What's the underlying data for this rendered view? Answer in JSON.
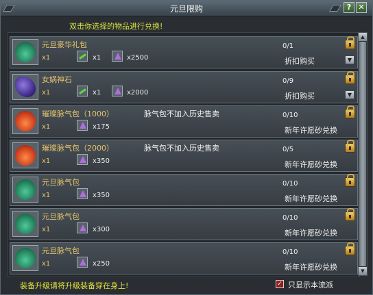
{
  "window": {
    "title": "元旦限购",
    "help_label": "?",
    "close_label": "✕"
  },
  "hint": "双击你选择的物品进行兑换!",
  "items": [
    {
      "name": "元旦豪华礼包",
      "note": "",
      "qty": "x1",
      "cost": [
        {
          "icon": "green-jade",
          "amount": "x1"
        },
        {
          "icon": "purple-crystal",
          "amount": "x2500"
        }
      ],
      "count": "0/1",
      "action": "折扣购买",
      "icon": "green-bag",
      "dropdown": true
    },
    {
      "name": "女娲神石",
      "note": "",
      "qty": "x1",
      "cost": [
        {
          "icon": "green-jade",
          "amount": "x1"
        },
        {
          "icon": "purple-crystal",
          "amount": "x2000"
        }
      ],
      "count": "0/9",
      "action": "折扣购买",
      "icon": "purple-stone",
      "dropdown": true
    },
    {
      "name": "璀璨脉气包（1000）",
      "note": "脉气包不加入历史售卖",
      "qty": "x1",
      "cost": [
        {
          "icon": "purple-crystal",
          "amount": "x175"
        }
      ],
      "count": "0/10",
      "action": "新年许愿砂兑换",
      "icon": "red-bag",
      "dropdown": false
    },
    {
      "name": "璀璨脉气包（2000）",
      "note": "脉气包不加入历史售卖",
      "qty": "x1",
      "cost": [
        {
          "icon": "purple-crystal",
          "amount": "x350"
        }
      ],
      "count": "0/5",
      "action": "新年许愿砂兑换",
      "icon": "red-bag",
      "dropdown": false
    },
    {
      "name": "元旦脉气包",
      "note": "",
      "qty": "x1",
      "cost": [
        {
          "icon": "purple-crystal",
          "amount": "x350"
        }
      ],
      "count": "0/10",
      "action": "新年许愿砂兑换",
      "icon": "green-bag",
      "dropdown": false
    },
    {
      "name": "元旦脉气包",
      "note": "",
      "qty": "x1",
      "cost": [
        {
          "icon": "purple-crystal",
          "amount": "x300"
        }
      ],
      "count": "0/10",
      "action": "新年许愿砂兑换",
      "icon": "green-bag",
      "dropdown": false
    },
    {
      "name": "元旦脉气包",
      "note": "",
      "qty": "x1",
      "cost": [
        {
          "icon": "purple-crystal",
          "amount": "x250"
        }
      ],
      "count": "0/10",
      "action": "新年许愿砂兑换",
      "icon": "green-bag",
      "dropdown": false
    }
  ],
  "footer": {
    "text": "装备升级请将升级装备穿在身上!",
    "filter_checked": true,
    "filter_label": "只显示本流派"
  }
}
